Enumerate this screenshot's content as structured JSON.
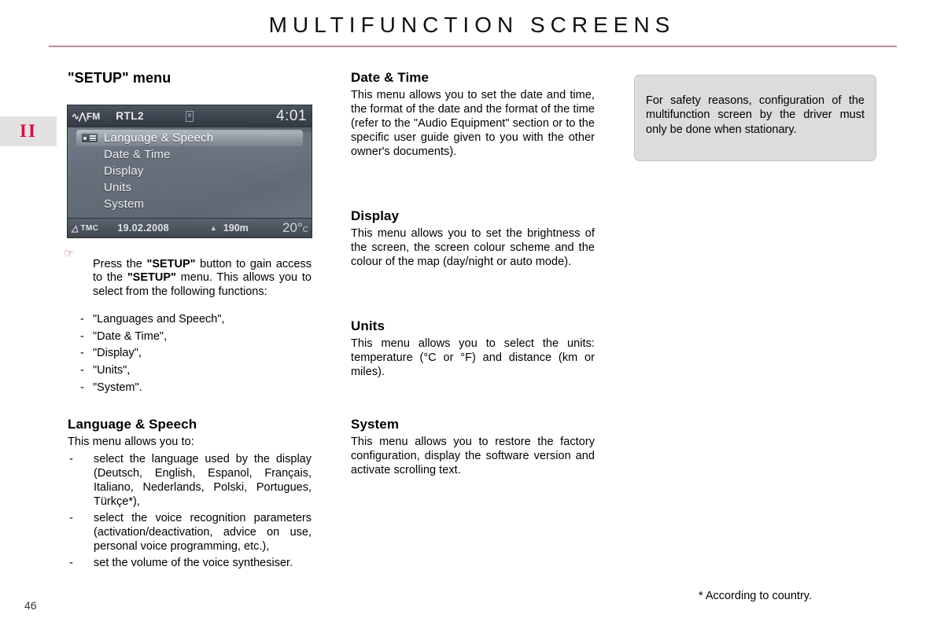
{
  "header": {
    "title": "MULTIFUNCTION SCREENS",
    "rule_color": "#b98aa0"
  },
  "chapter_tab": {
    "label": "II",
    "color": "#e2003c"
  },
  "device_screen": {
    "topbar": {
      "wave_icon": "wave-icon",
      "band": "FM",
      "station": "RTL2",
      "battery_icon": "battery-icon",
      "clock": "4:01"
    },
    "menu_items": [
      {
        "label": "Language & Speech",
        "selected": true,
        "icon": "speech-settings-icon"
      },
      {
        "label": "Date & Time",
        "selected": false,
        "icon": ""
      },
      {
        "label": "Display",
        "selected": false,
        "icon": ""
      },
      {
        "label": "Units",
        "selected": false,
        "icon": ""
      },
      {
        "label": "System",
        "selected": false,
        "icon": ""
      }
    ],
    "bottombar": {
      "tmc_icon": "tmc-warning-icon",
      "tmc_label": "TMC",
      "date": "19.02.2008",
      "altitude_icon": "altitude-triangle-icon",
      "altitude": "190m",
      "temperature": "20°",
      "temperature_unit": "C"
    }
  },
  "left_column": {
    "setup_heading": "\"SETUP\" menu",
    "press_icon": "pointing-hand-icon",
    "press_text_part1": "Press the ",
    "press_bold1": "\"SETUP\"",
    "press_text_part2": " button to gain access to the ",
    "press_bold2": "\"SETUP\"",
    "press_text_part3": " menu. This allows you to select from the following functions:",
    "setup_functions": [
      "\"Languages and Speech\",",
      "\"Date & Time\",",
      "\"Display\",",
      "\"Units\",",
      "\"System\"."
    ],
    "language_heading": "Language & Speech",
    "language_intro": "This menu allows you to:",
    "language_bullets": [
      "select the language used by the display (Deutsch, English, Espanol, Français, Italiano, Nederlands, Polski, Portugues, Türkçe*),",
      "select the voice recognition parameters (activation/deactivation, advice on use, personal voice programming, etc.),",
      "set the volume of the voice synthesiser."
    ]
  },
  "middle_column": {
    "sections": [
      {
        "heading": "Date & Time",
        "body": "This menu allows you to set the date and time, the format of the date and the format of the time (refer to the \"Audio Equipment\" section or to the specific user guide given to you with the other owner's documents)."
      },
      {
        "heading": "Display",
        "body": "This menu allows you to set the brightness of the screen, the screen colour scheme and the colour of the map (day/night or auto mode)."
      },
      {
        "heading": "Units",
        "body": "This menu allows you to select the units: temperature (°C or °F) and distance (km or miles)."
      },
      {
        "heading": "System",
        "body": "This menu allows you to restore the factory configuration, display the software version and activate scrolling text."
      }
    ]
  },
  "right_column": {
    "notice": "For safety reasons, configuration of the multifunction screen by the driver must only be done when stationary.",
    "footnote": "* According to country."
  },
  "footer": {
    "page_number": "46"
  }
}
